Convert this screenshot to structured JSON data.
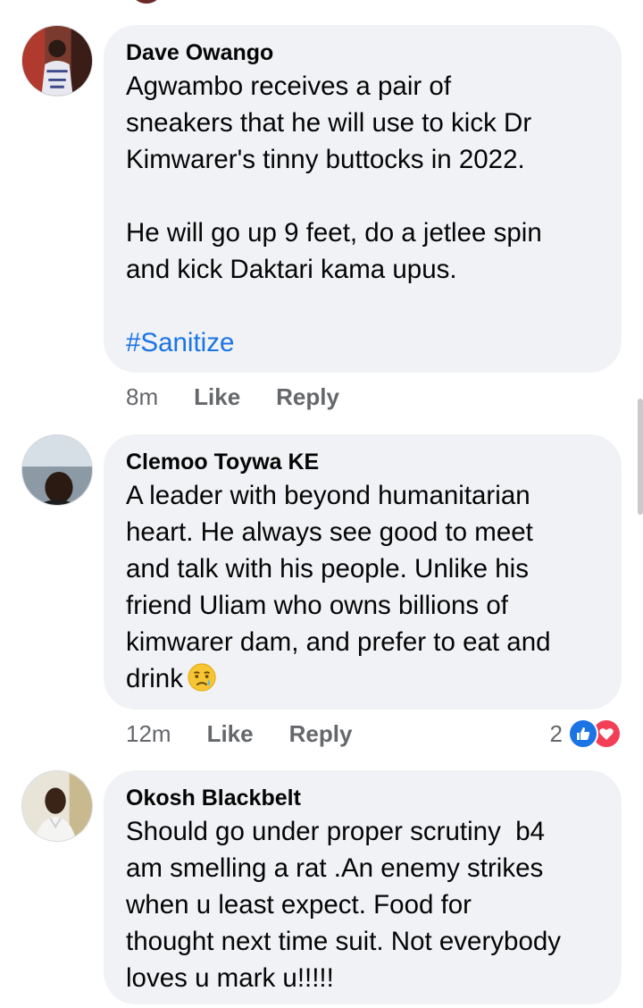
{
  "comments": [
    {
      "author": "Dave Owango",
      "paragraphs": [
        "Agwambo receives a pair of\nsneakers that he will use to kick Dr\nKimwarer's tinny buttocks in 2022.",
        "He will go up 9 feet, do a jetlee spin\nand kick Daktari kama upus."
      ],
      "hashtag": "#Sanitize",
      "time": "8m",
      "like_label": "Like",
      "reply_label": "Reply"
    },
    {
      "author": "Clemoo Toywa KE",
      "text": "A leader with beyond humanitarian\nheart. He always see good to meet\nand talk with his people. Unlike his\nfriend Uliam who owns billions of\nkimwarer dam, and prefer to eat and\ndrink",
      "emoji": "sad-relieved-face",
      "time": "12m",
      "like_label": "Like",
      "reply_label": "Reply",
      "reaction_count": "2",
      "reaction_icons": [
        "like-icon",
        "love-icon"
      ]
    },
    {
      "author": "Okosh Blackbelt",
      "text": "Should go under proper scrutiny  b4\nam smelling a rat .An enemy strikes\nwhen u least expect. Food for\nthought next time suit. Not everybody\nloves u mark u!!!!!"
    }
  ],
  "colors": {
    "bubble": "#f0f2f5",
    "meta": "#65676b",
    "hashtag": "#1b74e4",
    "like": "#1b74e4",
    "love": "#f33e58"
  }
}
